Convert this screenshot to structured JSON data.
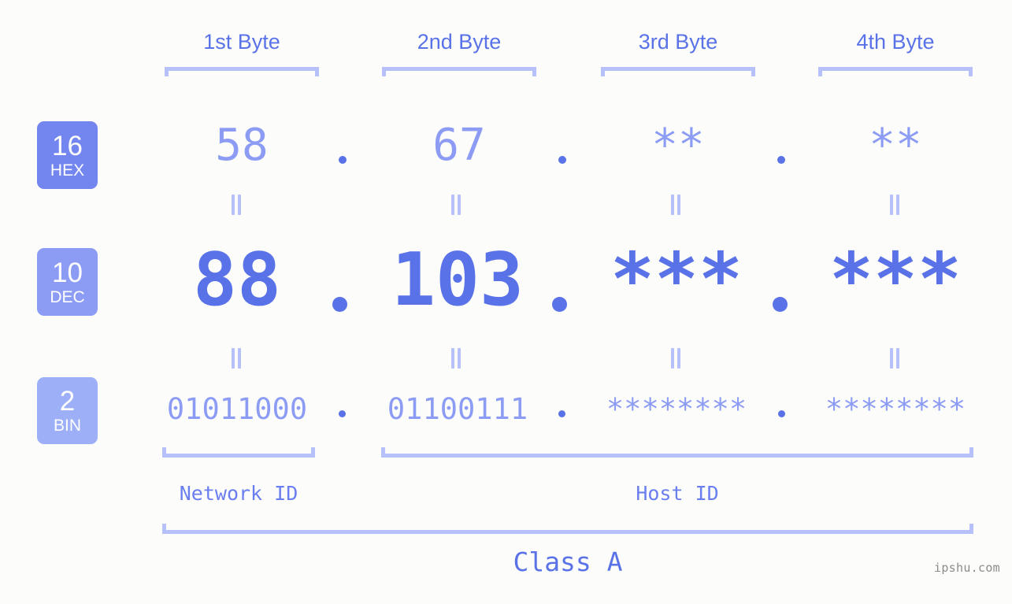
{
  "watermark": "ipshu.com",
  "byte_headers": [
    {
      "label": "1st Byte"
    },
    {
      "label": "2nd Byte"
    },
    {
      "label": "3rd Byte"
    },
    {
      "label": "4th Byte"
    }
  ],
  "bases": [
    {
      "num": "16",
      "name": "HEX"
    },
    {
      "num": "10",
      "name": "DEC"
    },
    {
      "num": "2",
      "name": "BIN"
    }
  ],
  "rows": {
    "hex": {
      "values": [
        "58",
        "67",
        "**",
        "**"
      ]
    },
    "dec": {
      "values": [
        "88",
        "103",
        "***",
        "***"
      ]
    },
    "bin": {
      "values": [
        "01011000",
        "01100111",
        "********",
        "********"
      ]
    }
  },
  "separator": ".",
  "id_sections": [
    {
      "label": "Network ID"
    },
    {
      "label": "Host ID"
    }
  ],
  "class_label": "Class A",
  "colors": {
    "background": "#fcfdfa",
    "accent_strong": "#5a72e8",
    "accent_mid": "#8c9cf4",
    "accent_light": "#b6c0fb",
    "badge_hex": "#7386ef",
    "badge_dec": "#8c9cf4",
    "badge_bin": "#9db0f7",
    "watermark": "#8b8b8b"
  }
}
